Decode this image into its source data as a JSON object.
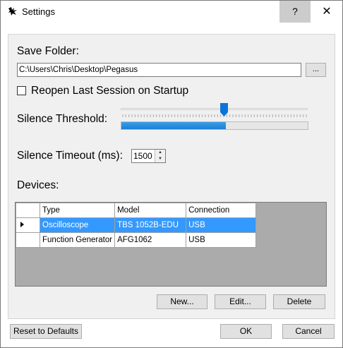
{
  "window": {
    "title": "Settings",
    "help_label": "?",
    "close_label": "✕"
  },
  "save_folder": {
    "label": "Save Folder:",
    "path": "C:\\Users\\Chris\\Desktop\\Pegasus",
    "browse_label": "..."
  },
  "reopen": {
    "label": "Reopen Last Session on Startup",
    "checked": false
  },
  "silence_threshold": {
    "label": "Silence Threshold:",
    "slider_fraction": 0.56,
    "level_fraction": 0.56
  },
  "silence_timeout": {
    "label": "Silence Timeout (ms):",
    "value": "1500"
  },
  "devices": {
    "label": "Devices:",
    "columns": [
      "Type",
      "Model",
      "Connection"
    ],
    "rows": [
      {
        "type": "Oscilloscope",
        "model": "TBS 1052B-EDU",
        "connection": "USB",
        "selected": true
      },
      {
        "type": "Function Generator",
        "model": "AFG1062",
        "connection": "USB",
        "selected": false
      }
    ],
    "new_label": "New...",
    "edit_label": "Edit...",
    "delete_label": "Delete"
  },
  "footer": {
    "reset_label": "Reset to Defaults",
    "ok_label": "OK",
    "cancel_label": "Cancel"
  },
  "colors": {
    "selection": "#3399ff",
    "accent": "#1a7fd6"
  }
}
